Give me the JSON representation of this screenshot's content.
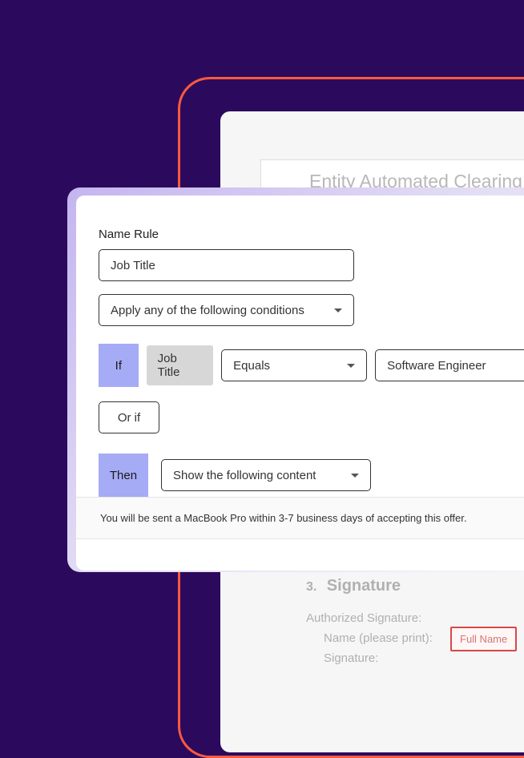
{
  "background": {
    "header_text": "Entity Automated Clearing H",
    "signature": {
      "number": "3.",
      "title": "Signature",
      "authorized_label": "Authorized Signature:",
      "name_label": "Name (please print):",
      "signature_label": "Signature:",
      "fullname_placeholder": "Full Name"
    }
  },
  "modal": {
    "name_rule_label": "Name Rule",
    "name_rule_value": "Job Title",
    "condition_mode": "Apply any of the following conditions",
    "if": {
      "label": "If",
      "field_chip": "Job Title",
      "operator": "Equals",
      "value": "Software Engineer"
    },
    "or_if_label": "Or if",
    "then": {
      "label": "Then",
      "action": "Show the following content",
      "content_preview": "You will be sent a MacBook Pro within 3-7 business days of accepting this offer."
    }
  }
}
